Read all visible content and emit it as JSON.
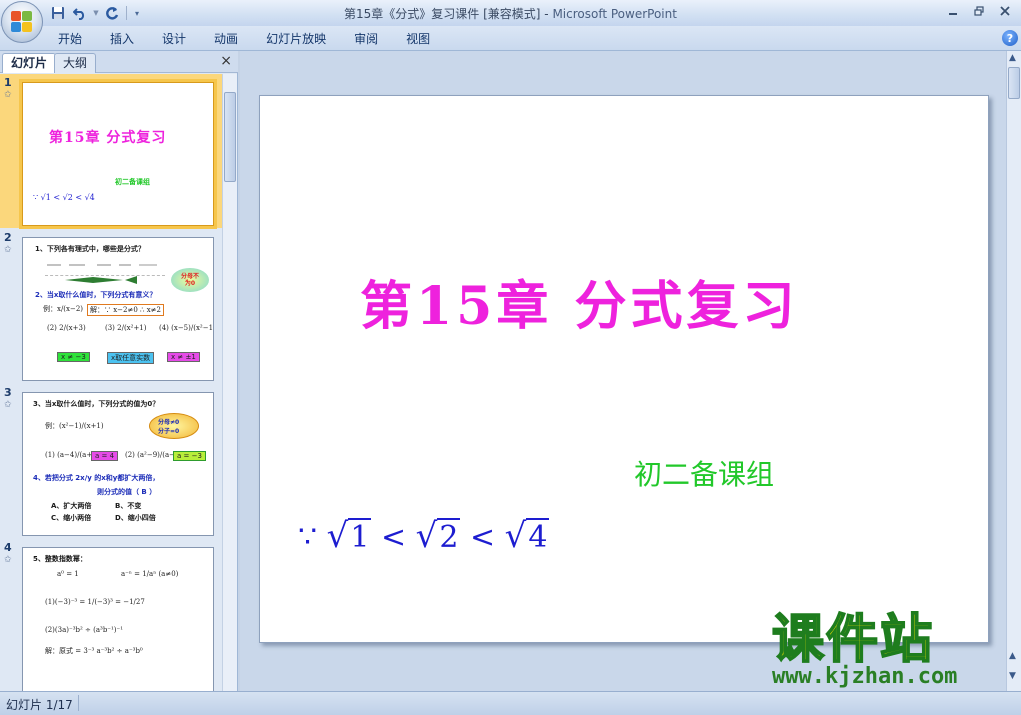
{
  "window": {
    "title_doc": "第15章《分式》复习课件 [兼容模式] - ",
    "title_app": "Microsoft PowerPoint"
  },
  "quick_access": {
    "save_icon": "save-icon",
    "undo_icon": "undo-icon",
    "repeat_icon": "repeat-icon",
    "customize_icon": "dropdown-icon"
  },
  "ribbon": {
    "tabs": [
      "开始",
      "插入",
      "设计",
      "动画",
      "幻灯片放映",
      "审阅",
      "视图"
    ],
    "help": "?"
  },
  "left_pane": {
    "tab_slides": "幻灯片",
    "tab_outline": "大纲",
    "close": "×"
  },
  "thumbnails": [
    {
      "number": "1",
      "title": "第15章 分式复习",
      "subtitle": "初二备课组",
      "formula": "∵ √1 < √2 < √4"
    },
    {
      "number": "2",
      "q1": "1、下列各有理式中，哪些是分式？",
      "q2": "2、当x取什么值时，下列分式有意义？",
      "example": "例：x/(x−2)",
      "answer": "解：∵ x−2≠0 ∴ x≠2",
      "bubble": "分母不为0",
      "items": [
        "(2) 2/(x+3)",
        "(3) 2/(x²+1)",
        "(4) (x−5)/(x²−1)"
      ],
      "tags": [
        "x ≠ −3",
        "x取任意实数",
        "x ≠ ±1"
      ]
    },
    {
      "number": "3",
      "q3": "3、当x取什么值时，下列分式的值为0？",
      "example": "例：(x²−1)/(x+1)",
      "bubble_top": "分母≠0",
      "bubble_bottom": "分子=0",
      "item1": "(1) (a−4)/(a+2)",
      "tag1": "a = 4",
      "item2": "(2) (a²−9)/(a−3)",
      "tag2": "a = −3",
      "q4": "4、若把分式 2x/y 的x和y都扩大两倍，",
      "q4b": "则分式的值（ B ）",
      "choices": [
        "A、扩大两倍",
        "B、不变",
        "C、缩小两倍",
        "D、缩小四倍"
      ]
    },
    {
      "number": "4",
      "q5": "5、整数指数幂：",
      "l1": "a⁰ = 1",
      "l2": "a⁻ⁿ = 1/aⁿ (a≠0)",
      "l3": "(1)(−3)⁻³ = 1/(−3)³ = −1/27",
      "l4": "(2)(3a)⁻³b² ÷ (a³b⁻¹)⁻¹",
      "l5": "解：原式 = 3⁻³ a⁻³b² ÷ a⁻³b⁰"
    }
  ],
  "slide": {
    "title": "第15章  分式复习",
    "subtitle": "初二备课组",
    "formula": {
      "because": "∵",
      "r1": "1",
      "lt1": "<",
      "r2": "2",
      "lt2": "<",
      "r3": "4"
    }
  },
  "watermark": {
    "text": "课件站",
    "url": "www.kjzhan.com"
  },
  "statusbar": {
    "slide_info": "幻灯片 1/17"
  }
}
